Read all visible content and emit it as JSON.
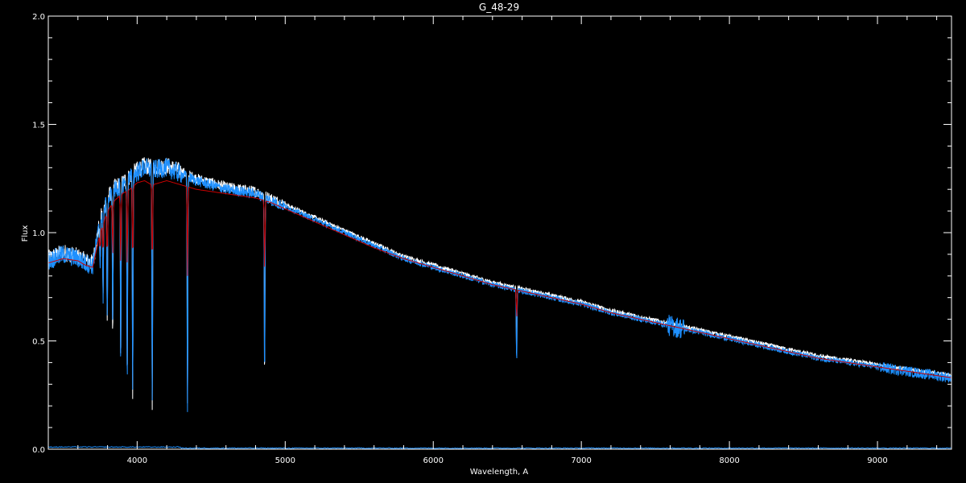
{
  "chart_data": {
    "type": "line",
    "title": "G_48-29",
    "xlabel": "Wavelength, A",
    "ylabel": "Flux",
    "xlim": [
      3400,
      9500
    ],
    "ylim": [
      0.0,
      2.0
    ],
    "xticks": [
      4000,
      5000,
      6000,
      7000,
      8000,
      9000
    ],
    "yticks": [
      "0.0",
      "0.5",
      "1.0",
      "1.5",
      "2.0"
    ],
    "colors": {
      "background": "#000000",
      "axes": "#ffffff",
      "observed": "#ffffff",
      "calibrated": "#1e90ff",
      "model": "#cc0000",
      "error": "#1e90ff"
    },
    "continuum": {
      "x": [
        3400,
        3500,
        3600,
        3650,
        3700,
        3750,
        3800,
        3850,
        3900,
        3950,
        4000,
        4050,
        4100,
        4200,
        4300,
        4400,
        4500,
        4600,
        4700,
        4800,
        4900,
        5000,
        5200,
        5400,
        5600,
        5800,
        6000,
        6200,
        6400,
        6600,
        6800,
        7000,
        7200,
        7400,
        7600,
        7800,
        8000,
        8200,
        8400,
        8600,
        8800,
        9000,
        9200,
        9400,
        9500
      ],
      "y": [
        0.87,
        0.9,
        0.88,
        0.86,
        0.85,
        1.05,
        1.15,
        1.2,
        1.22,
        1.25,
        1.28,
        1.3,
        1.29,
        1.3,
        1.27,
        1.24,
        1.22,
        1.2,
        1.19,
        1.18,
        1.15,
        1.12,
        1.06,
        1.0,
        0.94,
        0.88,
        0.84,
        0.8,
        0.76,
        0.73,
        0.7,
        0.67,
        0.63,
        0.6,
        0.57,
        0.54,
        0.51,
        0.48,
        0.45,
        0.42,
        0.4,
        0.38,
        0.36,
        0.34,
        0.33
      ]
    },
    "model": {
      "x": [
        3400,
        3500,
        3600,
        3650,
        3700,
        3750,
        3800,
        3850,
        3900,
        3950,
        4000,
        4050,
        4100,
        4200,
        4300,
        4400,
        4500,
        4600,
        4700,
        4800,
        4900,
        5000,
        5200,
        5400,
        5600,
        5800,
        6000,
        6200,
        6400,
        6600,
        6800,
        7000,
        7200,
        7400,
        7600,
        7800,
        8000,
        8200,
        8400,
        8600,
        8800,
        9000,
        9200,
        9400,
        9500
      ],
      "y": [
        0.86,
        0.88,
        0.87,
        0.85,
        0.84,
        1.0,
        1.1,
        1.15,
        1.18,
        1.2,
        1.23,
        1.24,
        1.22,
        1.24,
        1.22,
        1.2,
        1.19,
        1.18,
        1.17,
        1.16,
        1.14,
        1.11,
        1.05,
        0.99,
        0.93,
        0.88,
        0.84,
        0.8,
        0.76,
        0.73,
        0.7,
        0.67,
        0.63,
        0.6,
        0.57,
        0.54,
        0.51,
        0.48,
        0.45,
        0.42,
        0.4,
        0.38,
        0.36,
        0.34,
        0.33
      ]
    },
    "absorption_lines": [
      {
        "x": 3750,
        "depth": 0.2
      },
      {
        "x": 3770,
        "depth": 0.35
      },
      {
        "x": 3798,
        "depth": 0.5
      },
      {
        "x": 3835,
        "depth": 0.55
      },
      {
        "x": 3889,
        "depth": 0.7
      },
      {
        "x": 3933,
        "depth": 0.75
      },
      {
        "x": 3970,
        "depth": 0.8
      },
      {
        "x": 4102,
        "depth": 0.84
      },
      {
        "x": 4340,
        "depth": 0.85
      },
      {
        "x": 4861,
        "depth": 0.72
      },
      {
        "x": 6563,
        "depth": 0.45
      }
    ],
    "error_level": 0.01
  }
}
